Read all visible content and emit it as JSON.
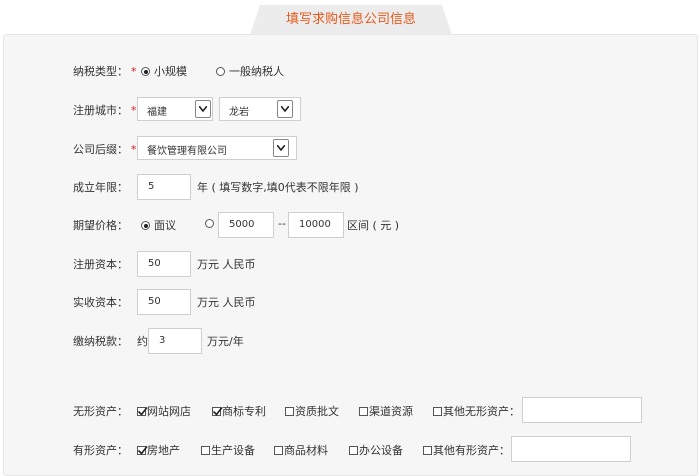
{
  "tab_title": "填写求购信息公司信息",
  "tax_type": {
    "label": "纳税类型：",
    "required": "*",
    "options": [
      {
        "label": "小规模",
        "selected": true
      },
      {
        "label": "一般纳税人",
        "selected": false
      }
    ]
  },
  "city": {
    "label": "注册城市：",
    "required": "*",
    "province": "福建",
    "city": "龙岩"
  },
  "suffix": {
    "label": "公司后缀：",
    "required": "*",
    "value": "餐饮管理有限公司"
  },
  "years": {
    "label": "成立年限：",
    "value": "5",
    "hint": "年 ( 填写数字,填0代表不限年限 )"
  },
  "price": {
    "label": "期望价格：",
    "negotiable": {
      "label": "面议",
      "selected": true
    },
    "range_selected": false,
    "min": "5000",
    "dash": "--",
    "max": "10000",
    "unit": "区间 ( 元 )"
  },
  "reg_capital": {
    "label": "注册资本：",
    "value": "50",
    "unit": "万元 人民币"
  },
  "paid_capital": {
    "label": "实收资本：",
    "value": "50",
    "unit": "万元 人民币"
  },
  "tax_paid": {
    "label": "缴纳税款：",
    "prefix": "约",
    "value": "3",
    "unit": "万元/年"
  },
  "intangible": {
    "label": "无形资产：",
    "items": [
      {
        "label": "网站网店",
        "checked": true
      },
      {
        "label": "商标专利",
        "checked": true
      },
      {
        "label": "资质批文",
        "checked": false
      },
      {
        "label": "渠道资源",
        "checked": false
      },
      {
        "label": "其他无形资产：",
        "checked": false
      }
    ],
    "other_value": ""
  },
  "tangible": {
    "label": "有形资产：",
    "items": [
      {
        "label": "房地产",
        "checked": true
      },
      {
        "label": "生产设备",
        "checked": false
      },
      {
        "label": "商品材料",
        "checked": false
      },
      {
        "label": "办公设备",
        "checked": false
      },
      {
        "label": "其他有形资产：",
        "checked": false
      }
    ],
    "other_value": ""
  }
}
